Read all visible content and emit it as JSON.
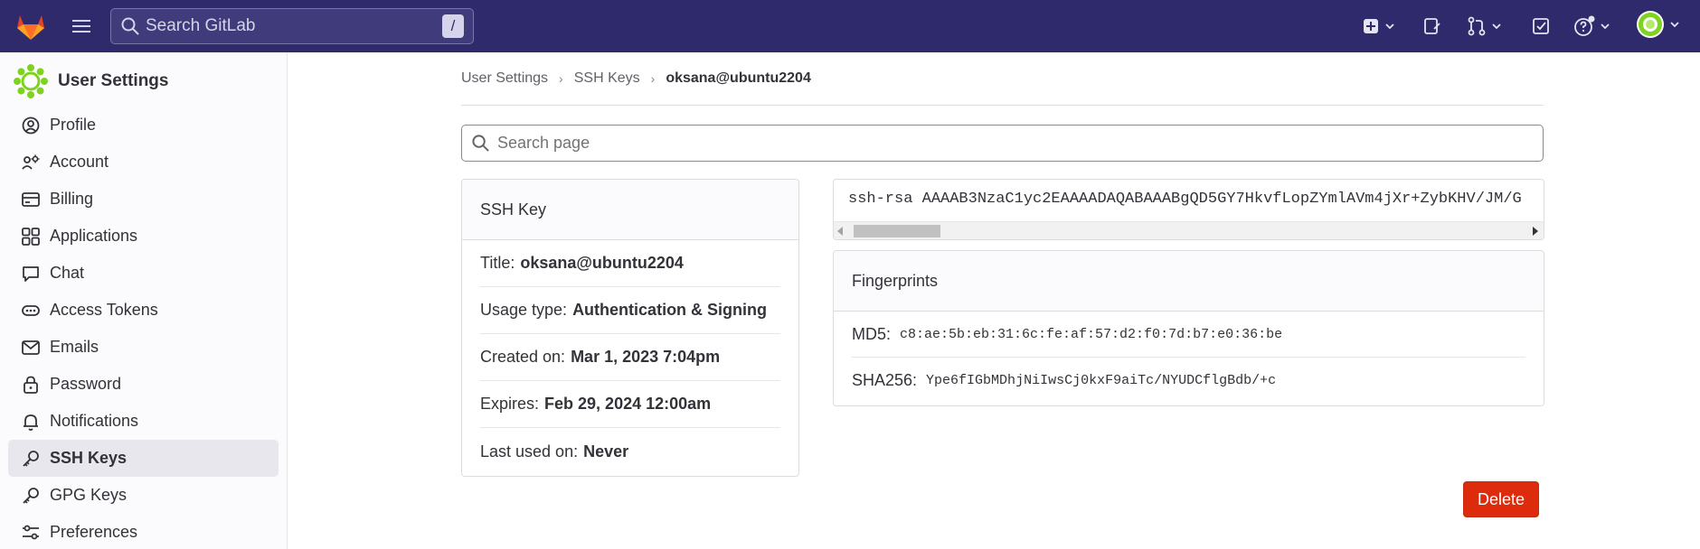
{
  "topbar": {
    "search_placeholder": "Search GitLab",
    "search_shortcut": "/"
  },
  "sidebar": {
    "title": "User Settings",
    "items": [
      {
        "label": "Profile",
        "icon": "profile-icon"
      },
      {
        "label": "Account",
        "icon": "account-icon"
      },
      {
        "label": "Billing",
        "icon": "billing-icon"
      },
      {
        "label": "Applications",
        "icon": "applications-icon"
      },
      {
        "label": "Chat",
        "icon": "chat-icon"
      },
      {
        "label": "Access Tokens",
        "icon": "token-icon"
      },
      {
        "label": "Emails",
        "icon": "mail-icon"
      },
      {
        "label": "Password",
        "icon": "lock-icon"
      },
      {
        "label": "Notifications",
        "icon": "bell-icon"
      },
      {
        "label": "SSH Keys",
        "icon": "key-icon",
        "active": true
      },
      {
        "label": "GPG Keys",
        "icon": "key-icon"
      },
      {
        "label": "Preferences",
        "icon": "preferences-icon"
      }
    ]
  },
  "breadcrumb": {
    "items": [
      "User Settings",
      "SSH Keys"
    ],
    "current": "oksana@ubuntu2204"
  },
  "page_search": {
    "placeholder": "Search page"
  },
  "ssh_key": {
    "header": "SSH Key",
    "title_label": "Title:",
    "title_value": "oksana@ubuntu2204",
    "usage_label": "Usage type:",
    "usage_value": "Authentication & Signing",
    "created_label": "Created on:",
    "created_value": "Mar 1, 2023 7:04pm",
    "expires_label": "Expires:",
    "expires_value": "Feb 29, 2024 12:00am",
    "last_used_label": "Last used on:",
    "last_used_value": "Never",
    "key_text": "ssh-rsa AAAAB3NzaC1yc2EAAAADAQABAAABgQD5GY7HkvfLopZYmlAVm4jXr+ZybKHV/JM/G"
  },
  "fingerprints": {
    "header": "Fingerprints",
    "md5_label": "MD5:",
    "md5_value": "c8:ae:5b:eb:31:6c:fe:af:57:d2:f0:7d:b7:e0:36:be",
    "sha256_label": "SHA256:",
    "sha256_value": "Ype6fIGbMDhjNiIwsCj0kxF9aiTc/NYUDCflgBdb/+c"
  },
  "delete_label": "Delete",
  "colors": {
    "topbar": "#2f2a6b",
    "danger": "#dd2b0e",
    "sidebar_active": "#e8e7ee"
  }
}
